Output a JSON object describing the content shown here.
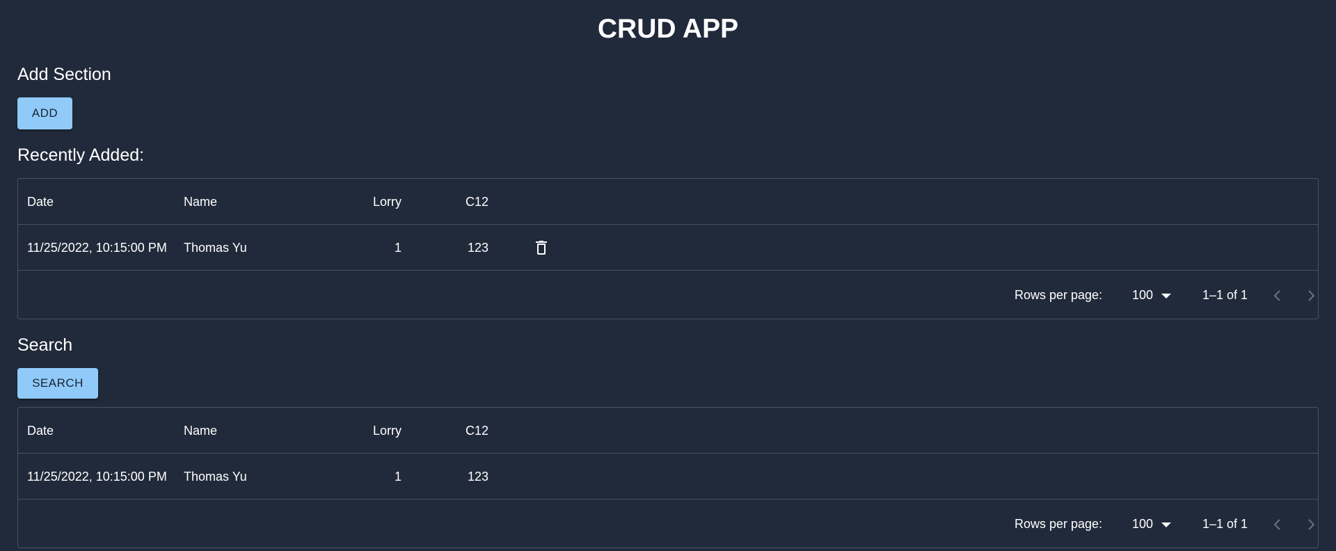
{
  "app": {
    "title": "CRUD APP"
  },
  "add_section": {
    "heading": "Add Section",
    "button_label": "ADD"
  },
  "recent": {
    "heading": "Recently Added:",
    "columns": [
      "Date",
      "Name",
      "Lorry",
      "C12"
    ],
    "rows": [
      {
        "date": "11/25/2022, 10:15:00 PM",
        "name": "Thomas Yu",
        "lorry": "1",
        "c12": "123",
        "action_icon": "delete-icon"
      }
    ],
    "footer": {
      "rows_per_page_label": "Rows per page:",
      "rows_per_page_value": "100",
      "page_info": "1–1 of 1"
    }
  },
  "search": {
    "heading": "Search",
    "button_label": "SEARCH",
    "columns": [
      "Date",
      "Name",
      "Lorry",
      "C12"
    ],
    "rows": [
      {
        "date": "11/25/2022, 10:15:00 PM",
        "name": "Thomas Yu",
        "lorry": "1",
        "c12": "123"
      }
    ],
    "footer": {
      "rows_per_page_label": "Rows per page:",
      "rows_per_page_value": "100",
      "page_info": "1–1 of 1"
    }
  },
  "colors": {
    "background": "#212a3a",
    "button": "#90caf9",
    "border": "#4a5260",
    "disabled_icon": "#6b7280"
  }
}
